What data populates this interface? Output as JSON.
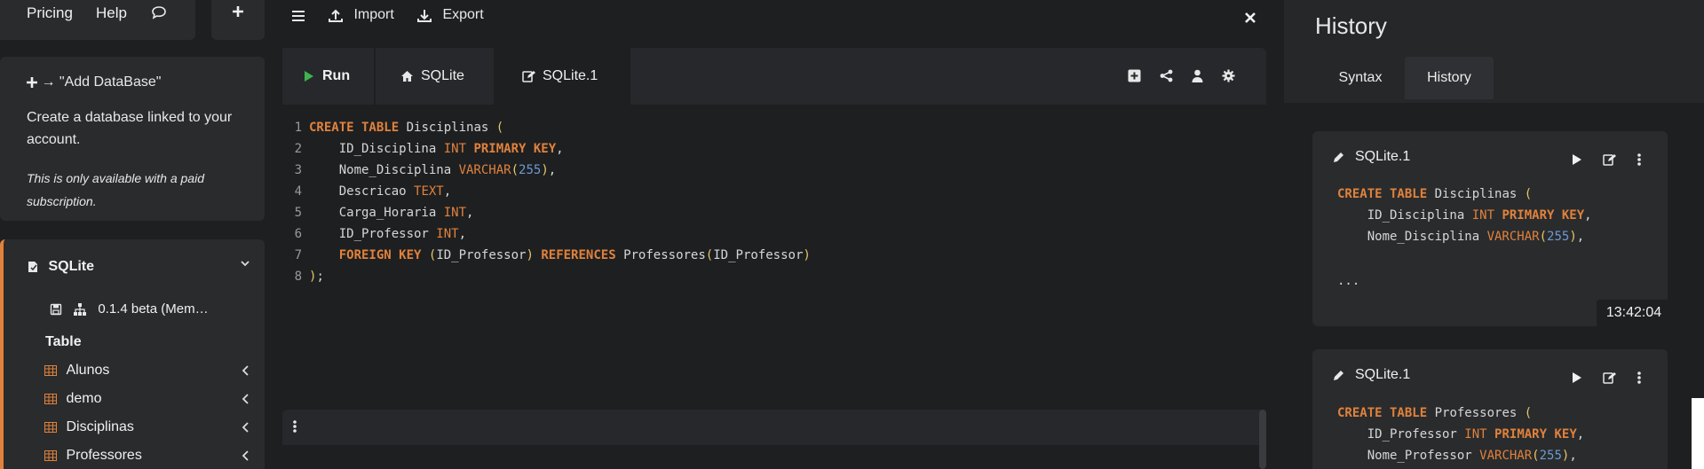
{
  "top_links": {
    "pricing": "Pricing",
    "help": "Help"
  },
  "add_db": {
    "title": "→ \"Add DataBase\"",
    "description": "Create a database linked to your account.",
    "note": "This is only available with a paid subscription."
  },
  "db_tree": {
    "name": "SQLite",
    "version": "0.1.4 beta (Mem…",
    "section": "Table",
    "tables": [
      "Alunos",
      "demo",
      "Disciplinas",
      "Professores"
    ]
  },
  "toolbar": {
    "import": "Import",
    "export": "Export"
  },
  "editor_tabs": {
    "run": "Run",
    "sqlite": "SQLite",
    "sqlite1": "SQLite.1"
  },
  "editor": {
    "line_numbers": [
      "1",
      "2",
      "3",
      "4",
      "5",
      "6",
      "7",
      "8"
    ]
  },
  "history": {
    "title": "History",
    "tabs": {
      "syntax": "Syntax",
      "history": "History"
    },
    "entries": [
      {
        "name": "SQLite.1",
        "time": "13:42:04",
        "ellipsis": "..."
      },
      {
        "name": "SQLite.1"
      }
    ]
  },
  "colors": {
    "accent": "#e0823c",
    "number": "#6c9bd2",
    "paren": "#e6c86b",
    "run_green": "#3fb34f"
  },
  "icons": [
    "comment-icon",
    "plus-icon",
    "menu-icon",
    "import-icon",
    "export-icon",
    "close-icon",
    "play-icon",
    "home-icon",
    "edit-icon",
    "add-box-icon",
    "share-icon",
    "user-icon",
    "gear-icon",
    "database-icon",
    "chevron-down-icon",
    "save-icon",
    "sitemap-icon",
    "table-icon",
    "chevron-left-icon",
    "kebab-icon",
    "pencil-icon"
  ]
}
